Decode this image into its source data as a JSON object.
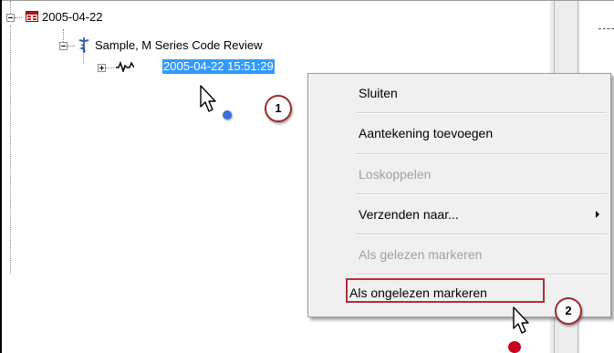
{
  "tree": {
    "date_node": {
      "label": "2005-04-22",
      "icon": "calendar-icon"
    },
    "review_node": {
      "label": "Sample, M Series Code Review",
      "icon": "caduceus-icon"
    },
    "record_node": {
      "label": "2005-04-22 15:51:29",
      "icon": "waveform-icon",
      "selected": true
    }
  },
  "context_menu": {
    "items": [
      {
        "label": "Sluiten",
        "enabled": true
      },
      {
        "label": "Aantekening toevoegen",
        "enabled": true
      },
      {
        "label": "Loskoppelen",
        "enabled": false
      },
      {
        "label": "Verzenden naar...",
        "enabled": true,
        "submenu": true
      },
      {
        "label": "Als gelezen markeren",
        "enabled": false
      },
      {
        "label": "Als ongelezen markeren",
        "enabled": true,
        "highlighted": true
      }
    ]
  },
  "callouts": [
    {
      "number": "1"
    },
    {
      "number": "2"
    }
  ],
  "colors": {
    "selection": "#3399ff",
    "callout_border": "#a02a2a",
    "highlight_box": "#b0303a",
    "menu_background": "#f0f0f0",
    "cursor_dot_1": "#3a6fd8",
    "cursor_dot_2": "#c8001e"
  }
}
